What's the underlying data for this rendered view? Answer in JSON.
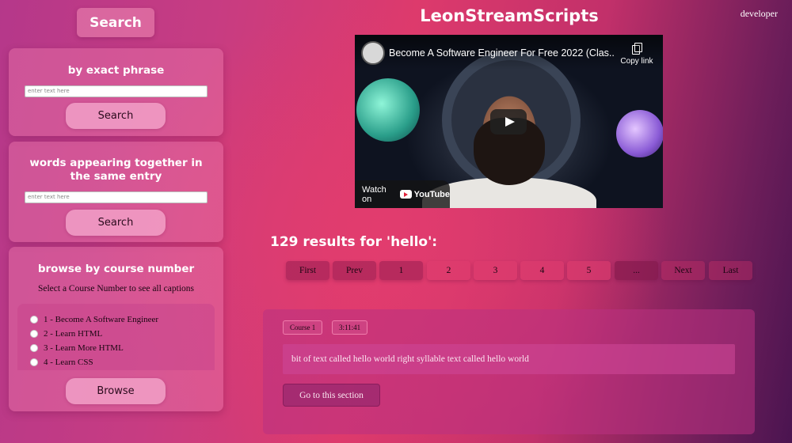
{
  "header": {
    "title": "LeonStreamScripts",
    "developer_link": "developer"
  },
  "sidebar": {
    "search_button": "Search",
    "exact_phrase": {
      "title": "by exact phrase",
      "placeholder": "enter text here",
      "button": "Search"
    },
    "words_together": {
      "title": "words appearing together in the same entry",
      "placeholder": "enter text here",
      "button": "Search"
    },
    "browse_course": {
      "title": "browse by course number",
      "subtitle": "Select a Course Number to see all captions",
      "courses": [
        "1 - Become A Software Engineer",
        "2 - Learn HTML",
        "3 - Learn More HTML",
        "4 - Learn CSS"
      ],
      "button": "Browse"
    }
  },
  "video": {
    "title": "Become A Software Engineer For Free 2022 (Clas...",
    "copy_link": "Copy link",
    "watch_on": "Watch on",
    "youtube": "YouTube"
  },
  "results": {
    "heading": "129 results for 'hello':",
    "pagination": [
      "First",
      "Prev",
      "1",
      "2",
      "3",
      "4",
      "5",
      "...",
      "Next",
      "Last"
    ],
    "items": [
      {
        "course": "Course 1",
        "timestamp": "3:11:41",
        "text": "bit of text called hello world right syllable text called hello world",
        "button": "Go to this section"
      }
    ]
  }
}
